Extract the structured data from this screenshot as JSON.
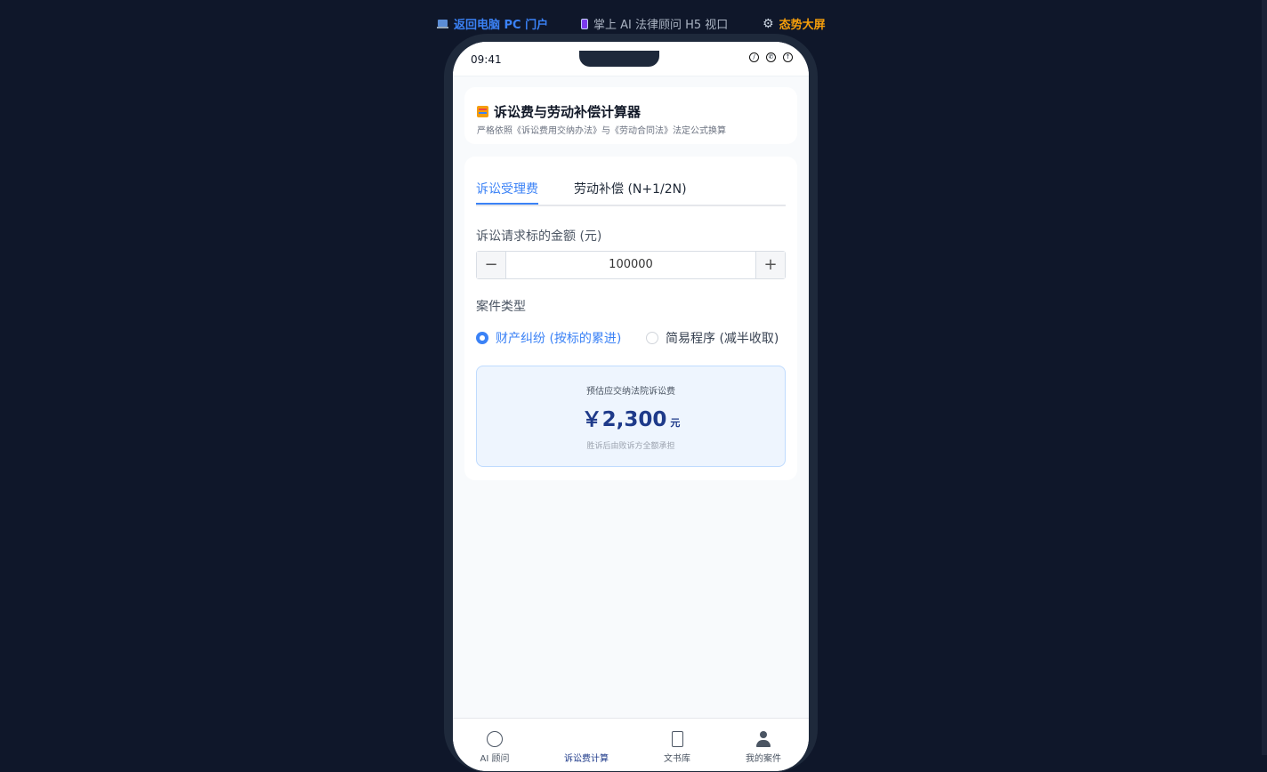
{
  "topbar": {
    "back_label": "返回电脑 PC 门户",
    "mid_label": "掌上 AI 法律顾问 H5 视口",
    "dashboard_label": "态势大屏"
  },
  "status": {
    "time": "09:41"
  },
  "header": {
    "title": "诉讼费与劳动补偿计算器",
    "subtitle": "严格依照《诉讼费用交纳办法》与《劳动合同法》法定公式换算"
  },
  "tabs": [
    {
      "label": "诉讼受理费",
      "active": true
    },
    {
      "label": "劳动补偿 (N+1/2N)",
      "active": false
    }
  ],
  "form": {
    "amount_label": "诉讼请求标的金额 (元)",
    "amount_value": "100000",
    "minus_symbol": "−",
    "plus_symbol": "+",
    "case_type_label": "案件类型",
    "options": [
      {
        "label": "财产纠纷 (按标的累进)",
        "selected": true
      },
      {
        "label": "简易程序 (减半收取)",
        "selected": false
      }
    ]
  },
  "result": {
    "label": "预估应交纳法院诉讼费",
    "amount": "￥2,300",
    "unit": "元",
    "note": "胜诉后由败诉方全额承担"
  },
  "nav": [
    {
      "label": "AI 顾问",
      "icon": "chat-icon"
    },
    {
      "label": "诉讼费计算",
      "icon": "calculator-icon",
      "active": true
    },
    {
      "label": "文书库",
      "icon": "document-icon"
    },
    {
      "label": "我的案件",
      "icon": "user-icon"
    }
  ],
  "colors": {
    "background": "#0f172a",
    "accent": "#3b82f6",
    "dashboard": "#f59e0b",
    "result_text": "#1e3a8a"
  }
}
